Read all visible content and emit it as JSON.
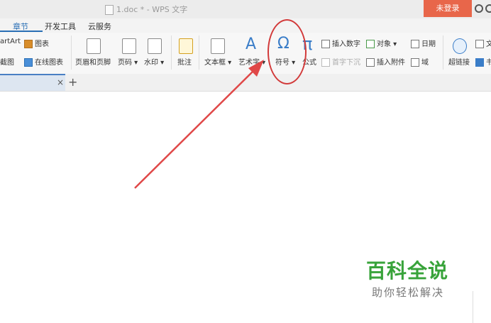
{
  "window": {
    "title": "1.doc * - WPS 文字",
    "login_label": "未登录"
  },
  "tabs": [
    "章节",
    "开发工具",
    "云服务"
  ],
  "ribbon": {
    "smartart": "artArt",
    "chart": "图表",
    "screenshot": "截图",
    "online_chart": "在线图表",
    "header_footer": "页眉和页脚",
    "page_number": "页码 ▾",
    "watermark": "水印 ▾",
    "comment": "批注",
    "textbox": "文本框 ▾",
    "wordart": "艺术字 ▾",
    "symbol": "符号 ▾",
    "formula": "公式",
    "insert_number": "插入数字",
    "object": "对象 ▾",
    "date": "日期",
    "drop_cap": "首字下沉",
    "insert_attachment": "插入附件",
    "field": "域",
    "hyperlink": "超链接",
    "edge_1": "文",
    "edge_2": "书"
  },
  "doc_tab": {
    "close": "×",
    "add": "+"
  },
  "watermark": {
    "title": "百科全说",
    "subtitle": "助你轻松解决"
  },
  "colors": {
    "accent": "#2a6fb5",
    "login": "#e8664a",
    "annotation": "#d23a3a",
    "brand": "#38a33a"
  }
}
